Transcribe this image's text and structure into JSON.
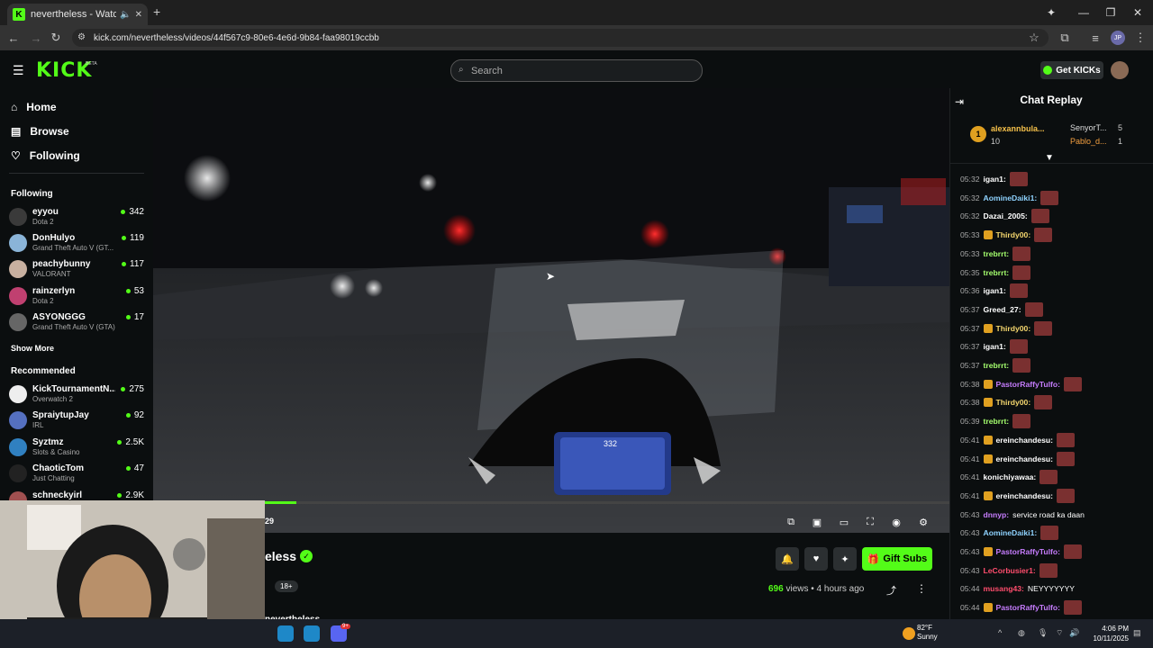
{
  "browser": {
    "tab_title": "nevertheless - Watch the V(",
    "url": "kick.com/nevertheless/videos/44f567c9-80e6-4e6d-9b84-faa98019ccbb",
    "profile_initials": "JP"
  },
  "header": {
    "logo": "KICK",
    "beta": "BETA",
    "search_placeholder": "Search",
    "get_kicks": "Get KICKs"
  },
  "sidebar": {
    "nav": [
      {
        "label": "Home",
        "icon": "home-icon"
      },
      {
        "label": "Browse",
        "icon": "browse-icon"
      },
      {
        "label": "Following",
        "icon": "heart-icon"
      }
    ],
    "following_title": "Following",
    "following": [
      {
        "name": "eyyou",
        "game": "Dota 2",
        "viewers": "342",
        "color": "#3a3a3a"
      },
      {
        "name": "DonHulyo",
        "game": "Grand Theft Auto V (GT...",
        "viewers": "119",
        "color": "#8ab4d8"
      },
      {
        "name": "peachybunny",
        "game": "VALORANT",
        "viewers": "117",
        "color": "#c8b0a0"
      },
      {
        "name": "rainzerlyn",
        "game": "Dota 2",
        "viewers": "53",
        "color": "#c04070"
      },
      {
        "name": "ASYONGGG",
        "game": "Grand Theft Auto V (GTA)",
        "viewers": "17",
        "color": "#666"
      }
    ],
    "show_more": "Show More",
    "recommended_title": "Recommended",
    "recommended": [
      {
        "name": "KickTournamentN...",
        "game": "Overwatch 2",
        "viewers": "275",
        "color": "#eee"
      },
      {
        "name": "SpraiytupJay",
        "game": "IRL",
        "viewers": "92",
        "color": "#5570c0"
      },
      {
        "name": "Syztmz",
        "game": "Slots & Casino",
        "viewers": "2.5K",
        "color": "#3080c0"
      },
      {
        "name": "ChaoticTom",
        "game": "Just Chatting",
        "viewers": "47",
        "color": "#222"
      },
      {
        "name": "schneckyirl",
        "game": "",
        "viewers": "2.9K",
        "color": "#a05050"
      }
    ]
  },
  "video": {
    "timecode": "29",
    "progress": 0.18,
    "speedometer": "332"
  },
  "stream": {
    "name": "eless",
    "age_badge": "18+",
    "gift_subs": "Gift Subs",
    "views_count": "696",
    "views_label": "views",
    "time_ago": "4 hours ago",
    "username_partial": "nevertheless"
  },
  "chat": {
    "title": "Chat Replay",
    "top_gifters": [
      {
        "rank": "1",
        "name": "alexannbula...",
        "count": "10"
      },
      {
        "name": "SenyorT...",
        "count": "5"
      },
      {
        "name": "Pablo_d...",
        "count": "1"
      }
    ],
    "messages": [
      {
        "ts": "05:32",
        "user": "igan1:",
        "color": "#ffffff",
        "text": "",
        "emote": true
      },
      {
        "ts": "05:32",
        "user": "AomineDaiki1:",
        "color": "#8fd3ff",
        "text": "",
        "emote": true
      },
      {
        "ts": "05:32",
        "user": "Dazai_2005:",
        "color": "#ffffff",
        "text": "",
        "emote": true
      },
      {
        "ts": "05:33",
        "user": "Thirdy00:",
        "color": "#f5d76e",
        "text": "",
        "emote": true,
        "badge": true
      },
      {
        "ts": "05:33",
        "user": "trebrrt:",
        "color": "#a5ff6e",
        "text": "",
        "emote": true
      },
      {
        "ts": "05:35",
        "user": "trebrrt:",
        "color": "#a5ff6e",
        "text": "",
        "emote": true
      },
      {
        "ts": "05:36",
        "user": "igan1:",
        "color": "#ffffff",
        "text": "",
        "emote": true
      },
      {
        "ts": "05:37",
        "user": "Greed_27:",
        "color": "#ffffff",
        "text": "",
        "emote": true
      },
      {
        "ts": "05:37",
        "user": "Thirdy00:",
        "color": "#f5d76e",
        "text": "",
        "emote": true,
        "badge": true
      },
      {
        "ts": "05:37",
        "user": "igan1:",
        "color": "#ffffff",
        "text": "",
        "emote": true
      },
      {
        "ts": "05:37",
        "user": "trebrrt:",
        "color": "#a5ff6e",
        "text": "",
        "emote": true
      },
      {
        "ts": "05:38",
        "user": "PastorRaffyTulfo:",
        "color": "#c77dff",
        "text": "",
        "emote": true,
        "badge": true
      },
      {
        "ts": "05:38",
        "user": "Thirdy00:",
        "color": "#f5d76e",
        "text": "",
        "emote": true,
        "badge": true
      },
      {
        "ts": "05:39",
        "user": "trebrrt:",
        "color": "#a5ff6e",
        "text": "",
        "emote": true
      },
      {
        "ts": "05:41",
        "user": "ereinchandesu:",
        "color": "#ffffff",
        "text": "",
        "emote": true,
        "badge": true
      },
      {
        "ts": "05:41",
        "user": "ereinchandesu:",
        "color": "#ffffff",
        "text": "",
        "emote": true,
        "badge": true
      },
      {
        "ts": "05:41",
        "user": "konichiyawaa:",
        "color": "#ffffff",
        "text": "",
        "emote": true
      },
      {
        "ts": "05:41",
        "user": "ereinchandesu:",
        "color": "#ffffff",
        "text": "",
        "emote": true,
        "badge": true
      },
      {
        "ts": "05:43",
        "user": "dnnyp:",
        "color": "#c77dff",
        "text": "service road ka daan",
        "emote": false
      },
      {
        "ts": "05:43",
        "user": "AomineDaiki1:",
        "color": "#8fd3ff",
        "text": "",
        "emote": true
      },
      {
        "ts": "05:43",
        "user": "PastorRaffyTulfo:",
        "color": "#c77dff",
        "text": "",
        "emote": true,
        "badge": true
      },
      {
        "ts": "05:43",
        "user": "LeCorbusier1:",
        "color": "#ff4d6d",
        "text": "",
        "emote": true
      },
      {
        "ts": "05:44",
        "user": "musang43:",
        "color": "#ff4d6d",
        "text": "NEYYYYYYY",
        "emote": false
      },
      {
        "ts": "05:44",
        "user": "PastorRaffyTulfo:",
        "color": "#c77dff",
        "text": "",
        "emote": true,
        "badge": true
      }
    ]
  },
  "taskbar": {
    "temp": "82°F",
    "weather": "Sunny",
    "time": "4:06 PM",
    "date": "10/11/2025",
    "discord_badge": "9+"
  },
  "colors": {
    "accent": "#53fc18",
    "bg": "#0b0e0f"
  }
}
